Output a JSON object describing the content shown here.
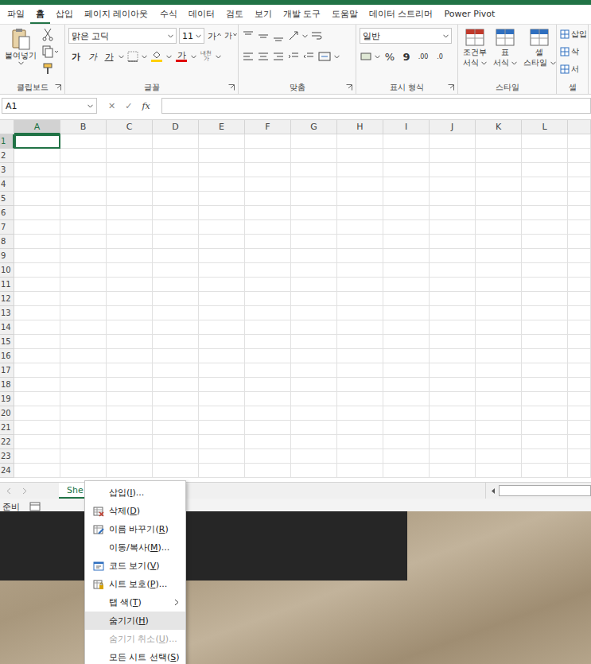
{
  "window": {
    "app": "Excel"
  },
  "ribbon_tabs": [
    {
      "label": "파일",
      "selected": false
    },
    {
      "label": "홈",
      "selected": true
    },
    {
      "label": "삽입",
      "selected": false
    },
    {
      "label": "페이지 레이아웃",
      "selected": false
    },
    {
      "label": "수식",
      "selected": false
    },
    {
      "label": "데이터",
      "selected": false
    },
    {
      "label": "검토",
      "selected": false
    },
    {
      "label": "보기",
      "selected": false
    },
    {
      "label": "개발 도구",
      "selected": false
    },
    {
      "label": "도움말",
      "selected": false
    },
    {
      "label": "데이터 스트리머",
      "selected": false
    },
    {
      "label": "Power Pivot",
      "selected": false
    }
  ],
  "ribbon": {
    "clipboard": {
      "label": "클립보드",
      "paste": "붙여넣기"
    },
    "font": {
      "label": "글꼴",
      "font_name": "맑은 고딕",
      "font_size": "11",
      "grow": "가",
      "shrink": "가",
      "bold": "가",
      "italic": "가",
      "underline": "가",
      "font_color": "가",
      "phonetic_top": "내천",
      "phonetic_bottom": "가"
    },
    "alignment": {
      "label": "맞춤"
    },
    "number": {
      "label": "표시 형식",
      "format": "일반",
      "percent": "%",
      "comma": "9",
      "increase_decimal": ".00",
      "decrease_decimal": ".0"
    },
    "styles": {
      "label": "스타일",
      "buttons": [
        [
          "조건부",
          "서식"
        ],
        [
          "표",
          "서식"
        ],
        [
          "셀",
          "스타일"
        ]
      ]
    },
    "cells": {
      "label": "셀",
      "buttons": [
        "삽입",
        "삭",
        "서"
      ]
    }
  },
  "formula_bar": {
    "name_box": "A1",
    "cancel": "✕",
    "enter": "✓",
    "function": "fx",
    "value": ""
  },
  "columns": [
    {
      "label": "A",
      "selected": true
    },
    {
      "label": "B",
      "selected": false
    },
    {
      "label": "C",
      "selected": false
    },
    {
      "label": "D",
      "selected": false
    },
    {
      "label": "E",
      "selected": false
    },
    {
      "label": "F",
      "selected": false
    },
    {
      "label": "G",
      "selected": false
    },
    {
      "label": "H",
      "selected": false
    },
    {
      "label": "I",
      "selected": false
    },
    {
      "label": "J",
      "selected": false
    },
    {
      "label": "K",
      "selected": false
    },
    {
      "label": "L",
      "selected": false
    }
  ],
  "rows": [
    {
      "label": "1",
      "selected": true
    },
    {
      "label": "2",
      "selected": false
    },
    {
      "label": "3",
      "selected": false
    },
    {
      "label": "4",
      "selected": false
    },
    {
      "label": "5",
      "selected": false
    },
    {
      "label": "6",
      "selected": false
    },
    {
      "label": "7",
      "selected": false
    },
    {
      "label": "8",
      "selected": false
    },
    {
      "label": "9",
      "selected": false
    },
    {
      "label": "10",
      "selected": false
    },
    {
      "label": "11",
      "selected": false
    },
    {
      "label": "12",
      "selected": false
    },
    {
      "label": "13",
      "selected": false
    },
    {
      "label": "14",
      "selected": false
    },
    {
      "label": "15",
      "selected": false
    },
    {
      "label": "16",
      "selected": false
    },
    {
      "label": "17",
      "selected": false
    },
    {
      "label": "18",
      "selected": false
    },
    {
      "label": "19",
      "selected": false
    },
    {
      "label": "20",
      "selected": false
    },
    {
      "label": "21",
      "selected": false
    },
    {
      "label": "22",
      "selected": false
    },
    {
      "label": "23",
      "selected": false
    },
    {
      "label": "24",
      "selected": false
    }
  ],
  "sheet_tabs": [
    {
      "label": "She",
      "selected": true
    }
  ],
  "status_bar": {
    "text": "준비"
  },
  "context_menu": [
    {
      "label": "삽입(I)...",
      "icon": "none",
      "disabled": false,
      "selected": false,
      "submenu": false
    },
    {
      "label": "삭제(D)",
      "icon": "delete",
      "disabled": false,
      "selected": false,
      "submenu": false
    },
    {
      "label": "이름 바꾸기(R)",
      "icon": "rename",
      "disabled": false,
      "selected": false,
      "submenu": false
    },
    {
      "label": "이동/복사(M)...",
      "icon": "none",
      "disabled": false,
      "selected": false,
      "submenu": false
    },
    {
      "label": "코드 보기(V)",
      "icon": "code",
      "disabled": false,
      "selected": false,
      "submenu": false
    },
    {
      "label": "시트 보호(P)...",
      "icon": "protect",
      "disabled": false,
      "selected": false,
      "submenu": false
    },
    {
      "label": "탭 색(T)",
      "icon": "none",
      "disabled": false,
      "selected": false,
      "submenu": true
    },
    {
      "label": "숨기기(H)",
      "icon": "none",
      "disabled": false,
      "selected": true,
      "submenu": false
    },
    {
      "label": "숨기기 취소(U)...",
      "icon": "none",
      "disabled": true,
      "selected": false,
      "submenu": false
    },
    {
      "label": "모든 시트 선택(S)",
      "icon": "none",
      "disabled": false,
      "selected": false,
      "submenu": false
    }
  ]
}
